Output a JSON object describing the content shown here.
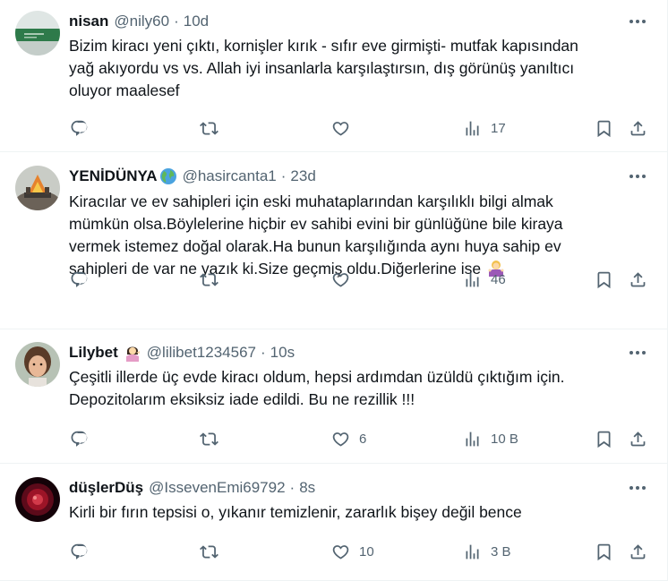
{
  "tweets": [
    {
      "name": "nisan",
      "handle": "@nily60",
      "time": "10d",
      "text_lines": [
        "Bizim kiracı yeni çıktı, kornişler kırık - sıfır eve girmişti- mutfak kapısından",
        "yağ akıyordu vs vs. Allah iyi insanlarla karşılaştırsın, dış görünüş yanıltıcı",
        "oluyor maalesef"
      ],
      "likes": "",
      "views": "17"
    },
    {
      "name": "YENİDÜNYA",
      "name_emoji": "globe-icon",
      "handle": "@hasircanta1",
      "time": "23d",
      "text_lines": [
        "Kiracılar ve ev sahipleri için eski muhataplarından karşılıklı bilgi almak",
        "mümkün olsa.Böylelerine hiçbir ev sahibi evini bir günlüğüne bile kiraya",
        "vermek istemez doğal olarak.Ha bunun karşılığında aynı huya sahip ev",
        "sahipleri de var ne yazık ki.Size geçmiş oldu.Diğerlerine ise"
      ],
      "likes": "",
      "views": "46"
    },
    {
      "name": "Lilybet",
      "name_emoji": "person-tipping-hand-icon",
      "handle": "@lilibet1234567",
      "time": "10s",
      "text_lines": [
        "Çeşitli illerde üç evde kiracı oldum, hepsi ardımdan üzüldü çıktığım için.",
        "Depozitolarım eksiksiz iade edildi. Bu ne rezillik !!!"
      ],
      "likes": "6",
      "views": "10 B"
    },
    {
      "name": "düşlerDüş",
      "handle": "@IssevenEmi69792",
      "time": "8s",
      "text_lines": [
        "Kirli bir fırın tepsisi o, yıkanır temizlenir, zararlık bişey değil bence"
      ],
      "likes": "10",
      "views": "3 B"
    }
  ],
  "colors": {
    "text": "#0f1419",
    "secondary": "#536471",
    "border": "#eff3f4"
  }
}
